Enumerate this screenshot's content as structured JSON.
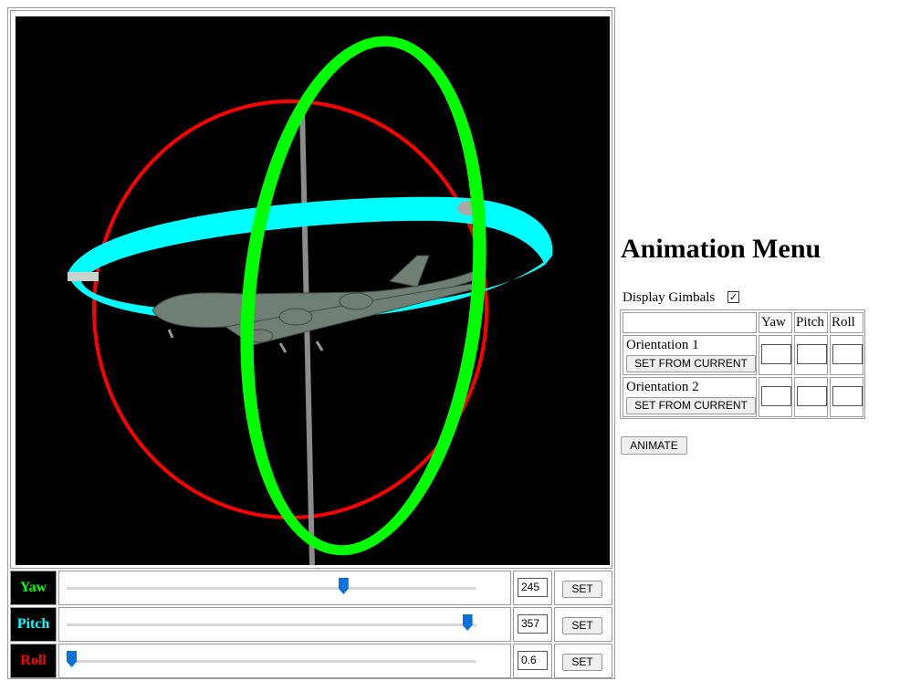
{
  "controls": [
    {
      "name": "Yaw",
      "color": "#00ff00",
      "value": "245",
      "level": 0.68,
      "set_label": "SET"
    },
    {
      "name": "Pitch",
      "color": "#00ffff",
      "value": "357",
      "level": 0.99,
      "set_label": "SET"
    },
    {
      "name": "Roll",
      "color": "#ff0000",
      "value": "0.6",
      "level": 0.0,
      "set_label": "SET"
    }
  ],
  "menu": {
    "title": "Animation Menu",
    "display_gimbals_label": "Display Gimbals",
    "display_gimbals_checked": true,
    "columns": [
      "Yaw",
      "Pitch",
      "Roll"
    ],
    "orientations": [
      {
        "label": "Orientation 1",
        "button": "SET FROM CURRENT"
      },
      {
        "label": "Orientation 2",
        "button": "SET FROM CURRENT"
      }
    ],
    "animate_label": "ANIMATE"
  },
  "scene": {
    "background": "#000000",
    "gimbal_colors": {
      "yaw": "#00ff00",
      "pitch": "#00ffff",
      "roll": "#ff0000"
    },
    "aircraft_color": "#6f7f73"
  }
}
